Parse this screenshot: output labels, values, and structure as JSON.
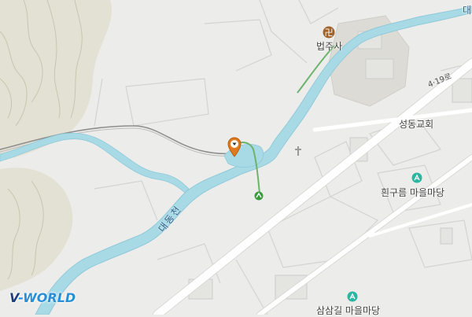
{
  "map": {
    "colors": {
      "land": "#ececea",
      "hill": "#e2e0d4",
      "water": "#a9dbe6",
      "water_edge": "#8cc8d8",
      "road": "#ffffff",
      "block_line": "#cfcfcf",
      "temple_area": "#dcdcd6",
      "green_path": "#5cab5f",
      "road_dark": "#8a8a8a"
    },
    "labels": {
      "temple": "법주사",
      "church": "성동교회",
      "playground1": "흰구름 마을마당",
      "playground2": "삼삼길 마을마당",
      "river": "대동천",
      "road": "4·19로",
      "edge": "대"
    },
    "icons": {
      "temple": "buddhist-temple-icon",
      "church": "church-icon",
      "playground1": "playground-icon",
      "playground2": "playground-icon",
      "location_marker": "location-pin-icon",
      "trail_marker": "trail-arrow-icon"
    },
    "logo": {
      "part1": "V",
      "part2": "-WORLD"
    }
  }
}
